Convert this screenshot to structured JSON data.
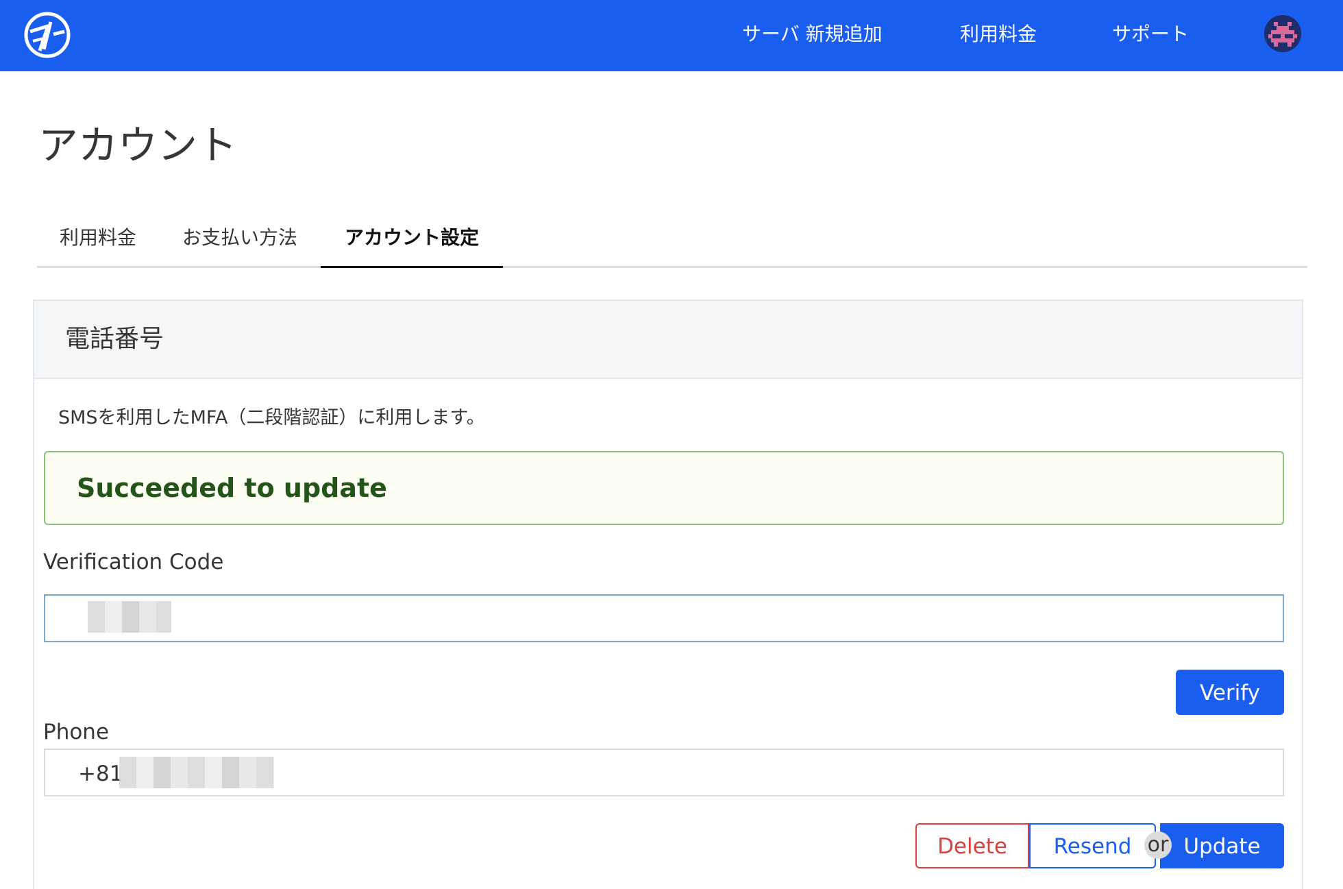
{
  "navbar": {
    "logo": "brand-logo-icon",
    "links": {
      "new_server": "サーバ 新規追加",
      "billing": "利用料金",
      "support": "サポート"
    },
    "avatar": "pixel-avatar-icon",
    "colors": {
      "background": "#1a5ef0",
      "text": "#ffffff"
    }
  },
  "page": {
    "title": "アカウント"
  },
  "tabs": {
    "billing": "利用料金",
    "payment_method": "お支払い方法",
    "account_settings": "アカウント設定",
    "active": "account_settings"
  },
  "phone_card": {
    "title": "電話番号",
    "description": "SMSを利用したMFA（二段階認証）に利用します。",
    "notice": {
      "text": "Succeeded to update",
      "colors": {
        "background": "#fbfdf3",
        "border": "#8cc277",
        "text": "#24541a"
      }
    },
    "verification": {
      "label": "Verification Code",
      "value": "",
      "verify_label": "Verify"
    },
    "phone": {
      "label": "Phone",
      "value": "+81"
    },
    "actions": {
      "delete_label": "Delete",
      "resend_label": "Resend",
      "or_label": "or",
      "update_label": "Update"
    },
    "colors": {
      "primary": "#1a5ef0",
      "danger": "#d9403d"
    }
  }
}
